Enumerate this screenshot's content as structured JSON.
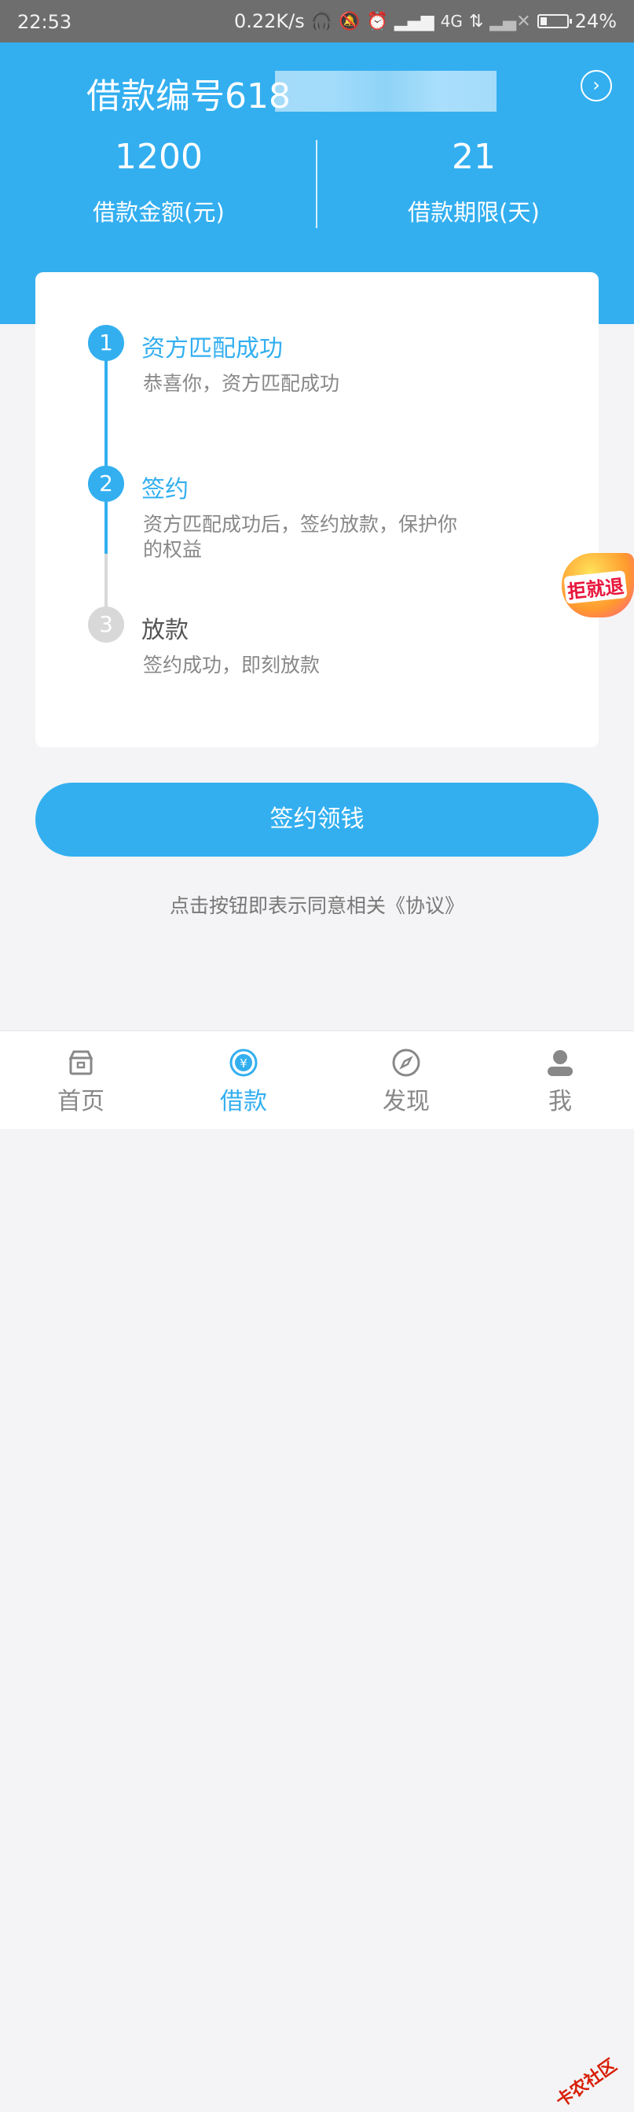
{
  "status_bar": {
    "time": "22:53",
    "speed": "0.22K/s",
    "network": "4G",
    "battery": "24%"
  },
  "header": {
    "loan_number_prefix": "借款编号618",
    "amount_value": "1200",
    "amount_label": "借款金额(元)",
    "term_value": "21",
    "term_label": "借款期限(天)",
    "detail_icon": "chevron-right-circle-icon"
  },
  "steps": [
    {
      "num": "1",
      "title": "资方匹配成功",
      "desc": "恭喜你，资方匹配成功",
      "state": "done"
    },
    {
      "num": "2",
      "title": "签约",
      "desc": "资方匹配成功后，签约放款，保护你的权益",
      "state": "current"
    },
    {
      "num": "3",
      "title": "放款",
      "desc": "签约成功，即刻放款",
      "state": "pending"
    }
  ],
  "actions": {
    "sign_button": "签约领钱",
    "agreement_text": "点击按钮即表示同意相关《协议》"
  },
  "tabs": [
    {
      "label": "首页",
      "icon": "home-shop-icon",
      "active": false
    },
    {
      "label": "借款",
      "icon": "yen-circle-icon",
      "active": true
    },
    {
      "label": "发现",
      "icon": "compass-icon",
      "active": false
    },
    {
      "label": "我",
      "icon": "user-icon",
      "active": false
    }
  ],
  "overlay": {
    "sticker_text": "拒就退",
    "watermark_text": "卡农社区"
  },
  "colors": {
    "primary": "#33aff0",
    "pending": "#d8d8d8",
    "text_muted": "#888888"
  }
}
